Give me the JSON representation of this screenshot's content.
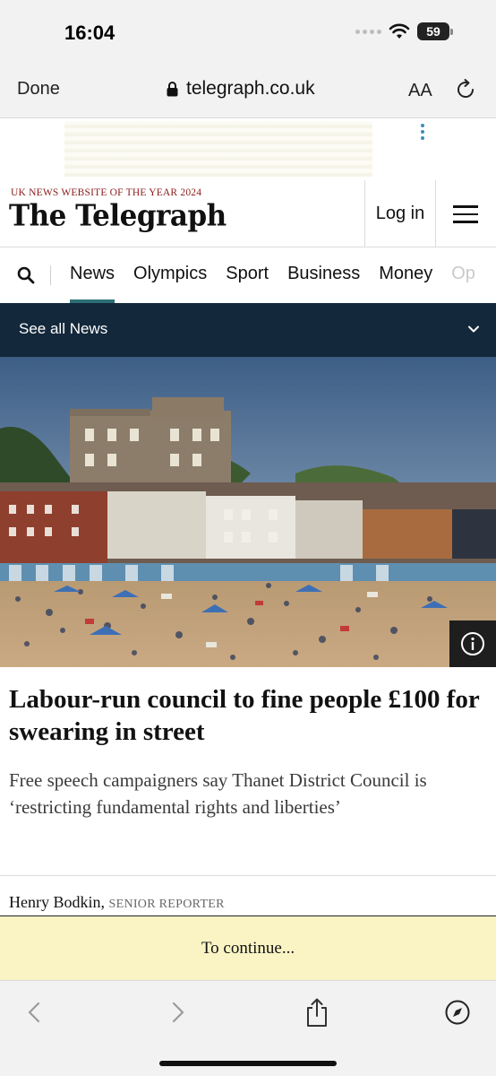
{
  "status_bar": {
    "time": "16:04",
    "battery": "59",
    "icons": [
      "signal-icon",
      "wifi-icon",
      "battery-icon"
    ]
  },
  "browser": {
    "done_label": "Done",
    "url": "telegraph.co.uk",
    "text_size_label": "AA",
    "icons": [
      "lock-icon",
      "reload-icon"
    ]
  },
  "site_header": {
    "award": "UK NEWS WEBSITE OF THE YEAR 2024",
    "logo": "The Telegraph",
    "login_label": "Log in",
    "icons": [
      "hamburger-menu-icon"
    ]
  },
  "nav": {
    "items": [
      "News",
      "Olympics",
      "Sport",
      "Business",
      "Money",
      "Op"
    ],
    "active": "News",
    "icons": [
      "search-icon"
    ]
  },
  "section_dropdown": {
    "label": "See all News",
    "icons": [
      "chevron-down-icon"
    ]
  },
  "hero": {
    "icons": [
      "info-icon"
    ]
  },
  "article": {
    "headline": "Labour-run council to fine people £100 for swearing in street",
    "standfirst": "Free speech campaigners say Thanet District Council is ‘restricting fundamental rights and liberties’",
    "author": "Henry Bodkin,",
    "role": "SENIOR REPORTER"
  },
  "paywall": {
    "label": "To continue..."
  },
  "toolbar": {
    "icons": [
      "back-icon",
      "forward-icon",
      "share-icon",
      "compass-icon"
    ]
  },
  "colors": {
    "accent": "#2c6e74",
    "dropdown_bg": "#13283a",
    "award_red": "#8b1a1a",
    "paywall_bg": "#faf4c5"
  }
}
